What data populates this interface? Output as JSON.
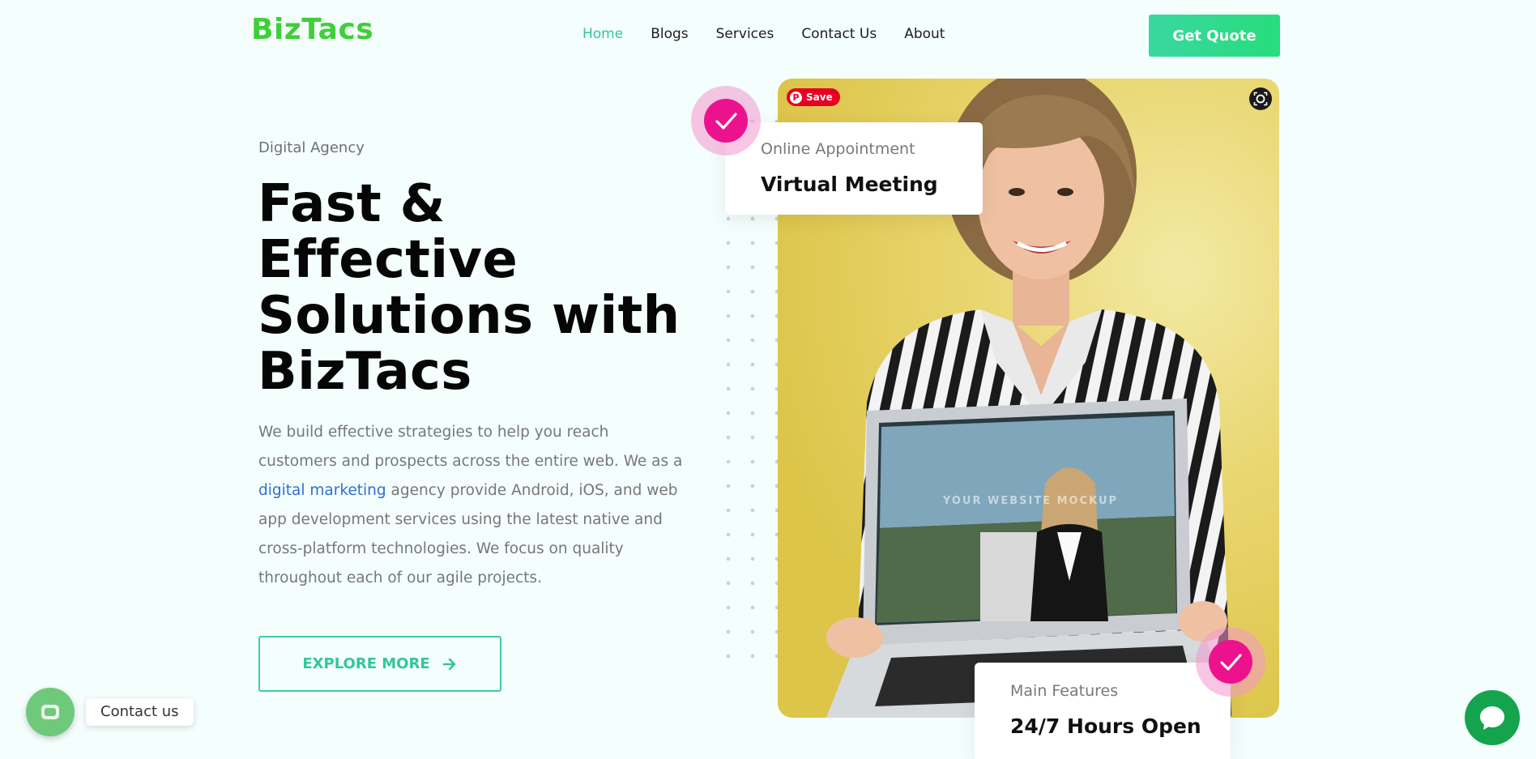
{
  "header": {
    "logo": "BizTacs",
    "nav": [
      {
        "label": "Home",
        "active": true
      },
      {
        "label": "Blogs",
        "active": false
      },
      {
        "label": "Services",
        "active": false
      },
      {
        "label": "Contact Us",
        "active": false
      },
      {
        "label": "About",
        "active": false
      }
    ],
    "cta_label": "Get Quote"
  },
  "hero": {
    "eyebrow": "Digital Agency",
    "title_lines": [
      "Fast &",
      "Effective",
      "Solutions with",
      "BizTacs"
    ],
    "body_before_link": "We build effective strategies to help you reach customers and prospects across the entire web. We as a ",
    "body_link": "digital marketing",
    "body_after_link": " agency provide Android, iOS, and web app development services using the latest native and cross-platform technologies. We focus on quality throughout each of our agile projects.",
    "button_label": "EXPLORE MORE"
  },
  "media": {
    "pin_save_label": "Save",
    "mockup_text": "YOUR WEBSITE MOCKUP"
  },
  "cards": {
    "appointment": {
      "sub": "Online Appointment",
      "main": "Virtual Meeting"
    },
    "features": {
      "sub": "Main Features",
      "main": "24/7 Hours Open"
    }
  },
  "widgets": {
    "contact_label": "Contact us"
  },
  "colors": {
    "brand_green": "#3fcf3a",
    "accent_teal": "#33c79a",
    "check_pink": "#ec128e",
    "link_blue": "#2f6fd0",
    "background": "#f4fefd"
  },
  "icons": [
    "check-icon",
    "arrow-right-icon",
    "pinterest-icon",
    "visual-search-icon",
    "phone-icon",
    "chat-bubble-icon"
  ]
}
